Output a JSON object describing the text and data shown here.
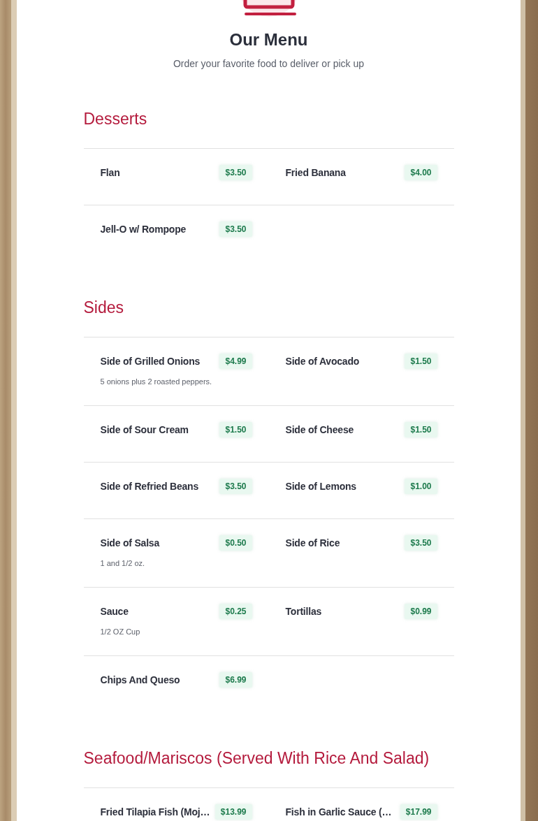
{
  "header": {
    "title": "Our Menu",
    "subtitle": "Order your favorite food to deliver or pick up"
  },
  "sections": [
    {
      "title": "Desserts",
      "items": [
        {
          "name": "Flan",
          "price": "$3.50"
        },
        {
          "name": "Fried Banana",
          "price": "$4.00"
        },
        {
          "name": "Jell-O w/ Rompope",
          "price": "$3.50"
        }
      ]
    },
    {
      "title": "Sides",
      "items": [
        {
          "name": "Side of Grilled Onions",
          "price": "$4.99",
          "description": "5 onions plus 2 roasted peppers."
        },
        {
          "name": "Side of Avocado",
          "price": "$1.50"
        },
        {
          "name": "Side of Sour Cream",
          "price": "$1.50"
        },
        {
          "name": "Side of Cheese",
          "price": "$1.50"
        },
        {
          "name": "Side of Refried Beans",
          "price": "$3.50"
        },
        {
          "name": "Side of Lemons",
          "price": "$1.00"
        },
        {
          "name": "Side of Salsa",
          "price": "$0.50",
          "description": "1 and 1/2 oz."
        },
        {
          "name": "Side of Rice",
          "price": "$3.50"
        },
        {
          "name": "Sauce",
          "price": "$0.25",
          "description": "1/2 OZ Cup"
        },
        {
          "name": "Tortillas",
          "price": "$0.99"
        },
        {
          "name": "Chips And Queso",
          "price": "$6.99"
        }
      ]
    },
    {
      "title": "Seafood/Mariscos (Served With Rice And Salad)",
      "items": [
        {
          "name": "Fried Tilapia Fish (Moj…",
          "price": "$13.99"
        },
        {
          "name": "Fish in Garlic Sauce (…",
          "price": "$17.99"
        }
      ]
    }
  ]
}
